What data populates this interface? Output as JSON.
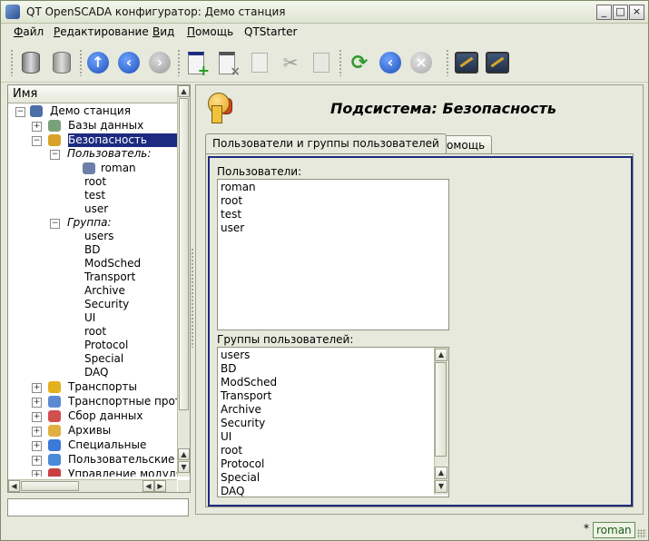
{
  "window": {
    "title": "QT OpenSCADA конфигуратор: Демо станция",
    "buttons": [
      "_",
      "□",
      "×"
    ]
  },
  "menu": [
    {
      "label": "Файл",
      "ul": "Ф",
      "rest": "айл"
    },
    {
      "label": "Редактирование",
      "ul": "Р",
      "rest": "едактирование"
    },
    {
      "label": "Вид",
      "ul": "В",
      "rest": "ид"
    },
    {
      "label": "Помощь",
      "ul": "П",
      "rest": "омощь"
    },
    {
      "label": "QTStarter",
      "ul": "",
      "rest": "QTStarter"
    }
  ],
  "toolbar": {
    "icons": [
      "db-load-icon",
      "db-save-icon",
      "up-icon",
      "back-icon",
      "forward-icon",
      "add-item-icon",
      "delete-item-icon",
      "copy-icon",
      "cut-icon",
      "paste-icon",
      "refresh-icon",
      "stop-back-icon",
      "stop-icon",
      "vision-icon",
      "config-icon"
    ]
  },
  "tree": {
    "header": "Имя",
    "items": [
      {
        "label": "Демо станция",
        "expander": "−",
        "icon": "station-icon",
        "icon_color": "#4d6fa8"
      },
      {
        "label": "Базы данных",
        "expander": "+",
        "icon": "database-icon",
        "icon_color": "#7aa27a"
      },
      {
        "label": "Безопасность",
        "expander": "−",
        "icon": "security-icon",
        "icon_color": "#d8a22b",
        "selected": true
      },
      {
        "label": "Пользователь:",
        "expander": "−",
        "italic": true
      },
      {
        "label": "roman",
        "icon": "user-icon",
        "icon_color": "#6b7fa8"
      },
      {
        "label": "root"
      },
      {
        "label": "test"
      },
      {
        "label": "user"
      },
      {
        "label": "Группа:",
        "expander": "−",
        "italic": true
      },
      {
        "label": "users"
      },
      {
        "label": "BD"
      },
      {
        "label": "ModSched"
      },
      {
        "label": "Transport"
      },
      {
        "label": "Archive"
      },
      {
        "label": "Security"
      },
      {
        "label": "UI"
      },
      {
        "label": "root"
      },
      {
        "label": "Protocol"
      },
      {
        "label": "Special"
      },
      {
        "label": "DAQ"
      },
      {
        "label": "Транспорты",
        "expander": "+",
        "icon": "transport-icon",
        "icon_color": "#e2b21e"
      },
      {
        "label": "Транспортные прото",
        "expander": "+",
        "icon": "protocol-icon",
        "icon_color": "#5b8ad4"
      },
      {
        "label": "Сбор данных",
        "expander": "+",
        "icon": "daq-icon",
        "icon_color": "#d05050"
      },
      {
        "label": "Архивы",
        "expander": "+",
        "icon": "archive-icon",
        "icon_color": "#e0b040"
      },
      {
        "label": "Специальные",
        "expander": "+",
        "icon": "special-icon",
        "icon_color": "#3a7ad8"
      },
      {
        "label": "Пользовательские и",
        "expander": "+",
        "icon": "ui-icon",
        "icon_color": "#4a8ad8"
      },
      {
        "label": "Управление модуля",
        "expander": "+",
        "icon": "modules-icon",
        "icon_color": "#c84040"
      }
    ]
  },
  "header": {
    "title": "Подсистема: Безопасность"
  },
  "tabs": [
    {
      "label": "Пользователи и группы пользователей",
      "active": true
    },
    {
      "label": "Помощь",
      "active": false
    }
  ],
  "users": {
    "label": "Пользователи:",
    "items": [
      "roman",
      "root",
      "test",
      "user"
    ]
  },
  "groups": {
    "label": "Группы пользователей:",
    "items": [
      "users",
      "BD",
      "ModSched",
      "Transport",
      "Archive",
      "Security",
      "UI",
      "root",
      "Protocol",
      "Special",
      "DAQ"
    ]
  },
  "status": {
    "mark": "*",
    "user": "roman"
  }
}
